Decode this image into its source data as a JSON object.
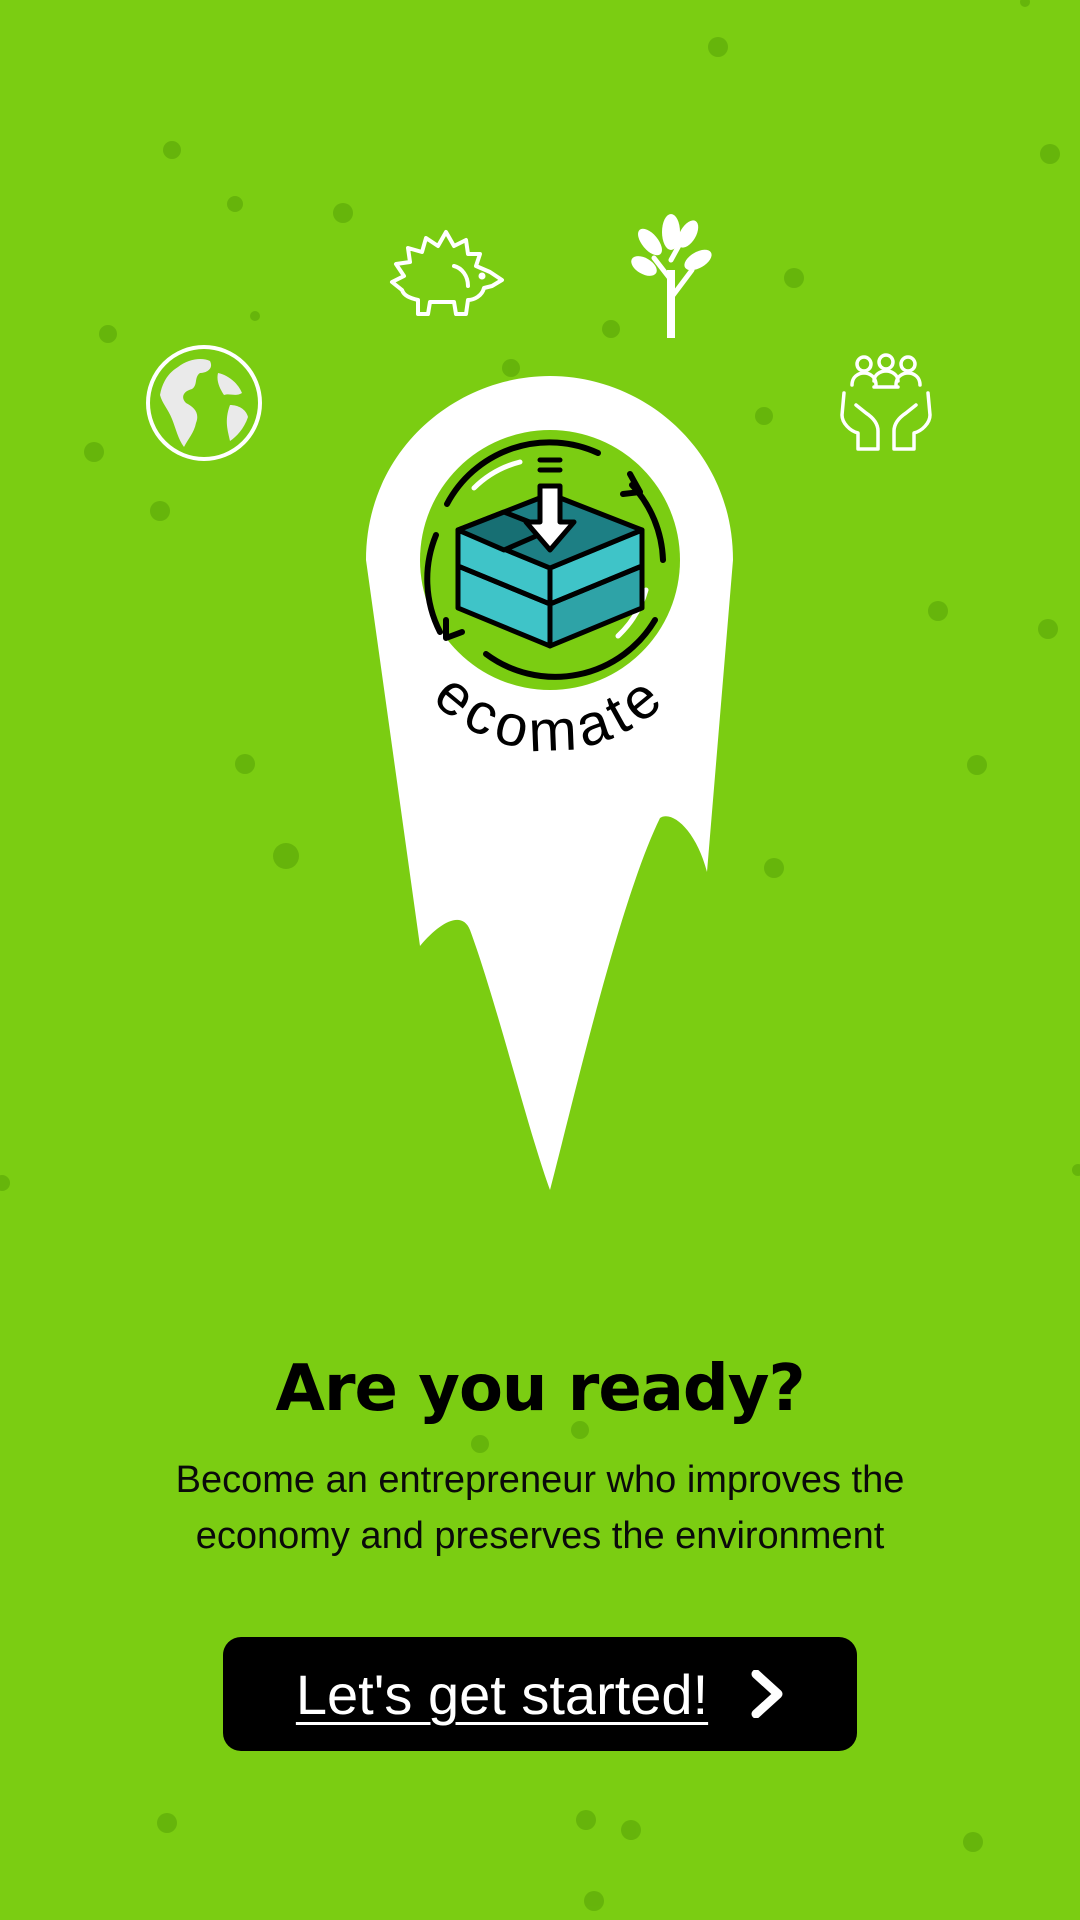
{
  "brand": {
    "name": "ecomate",
    "accent_color": "#7bcd12",
    "box_color": "#3fc4c8"
  },
  "icons": [
    "globe-icon",
    "hedgehog-icon",
    "tree-icon",
    "community-hands-icon"
  ],
  "onboarding": {
    "headline": "Are you ready?",
    "subtext": "Become an entrepreneur who improves the economy and preserves the environment",
    "cta_label": "Let's get started!"
  }
}
